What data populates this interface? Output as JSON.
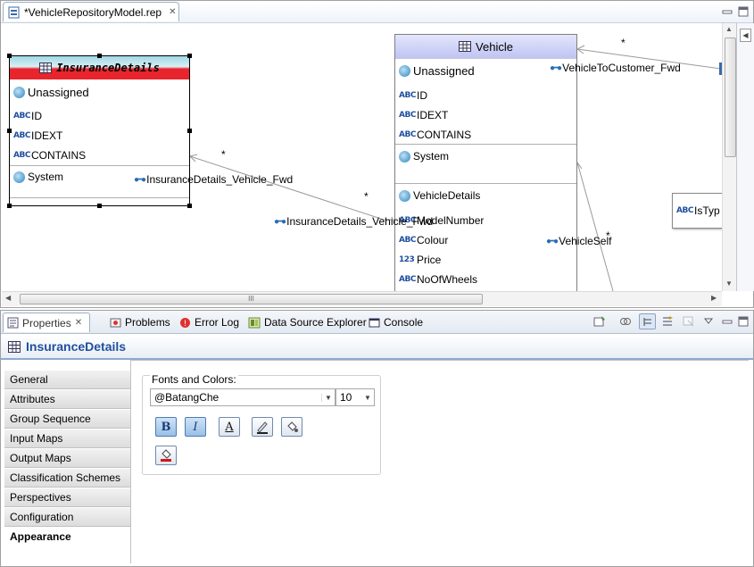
{
  "editor": {
    "tab_title": "*VehicleRepositoryModel.rep",
    "close_glyph": "✕"
  },
  "diagram": {
    "insurance": {
      "title": "InsuranceDetails",
      "unassigned": "Unassigned",
      "attributes": [
        "ID",
        "IDEXT",
        "CONTAINS"
      ],
      "system": "System"
    },
    "vehicle": {
      "title": "Vehicle",
      "unassigned": "Unassigned",
      "attributes": [
        "ID",
        "IDEXT",
        "CONTAINS"
      ],
      "system": "System",
      "details_group": "VehicleDetails",
      "detail_items": [
        {
          "type": "ABC",
          "name": "ModelNumber"
        },
        {
          "type": "ABC",
          "name": "Colour"
        },
        {
          "type": "123",
          "name": "Price"
        },
        {
          "type": "ABC",
          "name": "NoOfWheels"
        }
      ]
    },
    "istype_box": "IsTyp",
    "relations": {
      "vehicle_to_customer": "VehicleToCustomer_Fwd",
      "insurance_vehicle_fwd_1": "InsuranceDetails_Vehicle_Fwd",
      "insurance_vehicle_fwd_2": "InsuranceDetails_Vehicle_Fwd",
      "vehicle_self": "VehicleSelf",
      "mult_star": "*"
    },
    "scroll_thumb_glyph": "III"
  },
  "properties": {
    "tabs": [
      {
        "label": "Properties",
        "icon": "properties-icon",
        "active": true
      },
      {
        "label": "Problems",
        "icon": "problems-icon"
      },
      {
        "label": "Error Log",
        "icon": "error-log-icon"
      },
      {
        "label": "Data Source Explorer",
        "icon": "data-source-icon"
      },
      {
        "label": "Console",
        "icon": "console-icon"
      }
    ],
    "title": "InsuranceDetails",
    "categories": [
      "General",
      "Attributes",
      "Group Sequence",
      "Input Maps",
      "Output Maps",
      "Classification Schemes",
      "Perspectives",
      "Configuration",
      "Appearance"
    ],
    "selected_category": "Appearance",
    "fonts_group_label": "Fonts and Colors:",
    "font_name": "@BatangChe",
    "font_size": "10",
    "format_buttons": {
      "bold": "B",
      "italic": "I",
      "font_color": "A"
    }
  },
  "colors": {
    "insurance_header_top": "#9fd8e6",
    "insurance_header_bottom": "#e8242c",
    "vehicle_header": "#c9cdf5",
    "accent_blue": "#1f4f9f"
  }
}
